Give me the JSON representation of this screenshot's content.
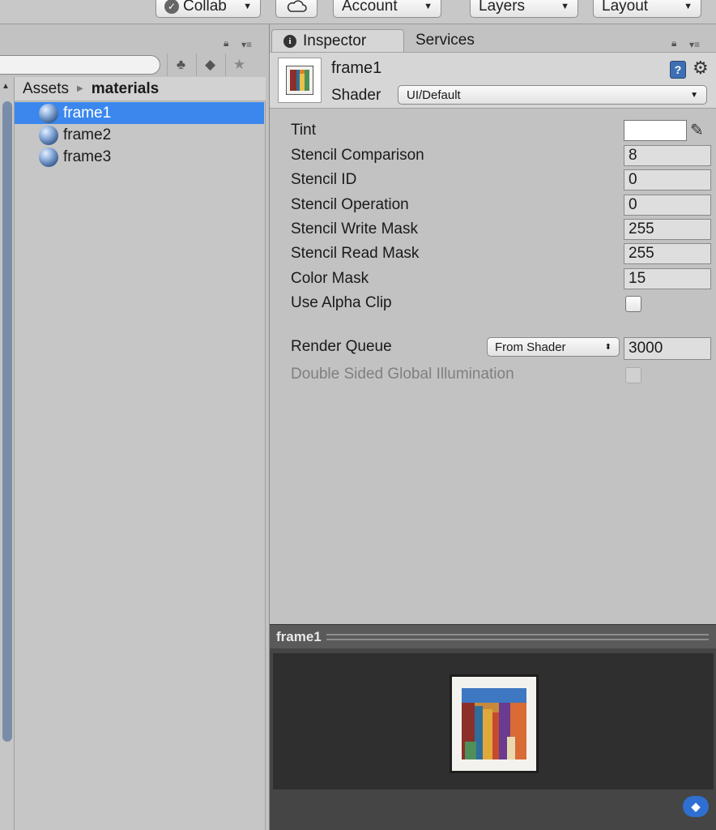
{
  "toolbar": {
    "collab_label": "Collab",
    "account_label": "Account",
    "layers_label": "Layers",
    "layout_label": "Layout"
  },
  "project": {
    "breadcrumb": [
      "Assets",
      "materials"
    ],
    "items": [
      {
        "label": "frame1",
        "selected": true
      },
      {
        "label": "frame2",
        "selected": false
      },
      {
        "label": "frame3",
        "selected": false
      }
    ]
  },
  "inspector": {
    "tabs": [
      "Inspector",
      "Services"
    ],
    "material_name": "frame1",
    "shader_label": "Shader",
    "shader_value": "UI/Default",
    "properties": [
      {
        "label": "Tint",
        "kind": "color",
        "value": "#ffffff"
      },
      {
        "label": "Stencil Comparison",
        "kind": "number",
        "value": "8"
      },
      {
        "label": "Stencil ID",
        "kind": "number",
        "value": "0"
      },
      {
        "label": "Stencil Operation",
        "kind": "number",
        "value": "0"
      },
      {
        "label": "Stencil Write Mask",
        "kind": "number",
        "value": "255"
      },
      {
        "label": "Stencil Read Mask",
        "kind": "number",
        "value": "255"
      },
      {
        "label": "Color Mask",
        "kind": "number",
        "value": "15"
      },
      {
        "label": "Use Alpha Clip",
        "kind": "checkbox",
        "checked": false
      }
    ],
    "render_queue": {
      "label": "Render Queue",
      "mode": "From Shader",
      "value": "3000"
    },
    "double_sided_gi": {
      "label": "Double Sided Global Illumination",
      "checked": false,
      "disabled": true
    }
  },
  "preview": {
    "title": "frame1"
  },
  "colors": {
    "selection": "#3b87ee",
    "panel": "#c2c2c2",
    "preview_bg": "#2f2f2f"
  }
}
